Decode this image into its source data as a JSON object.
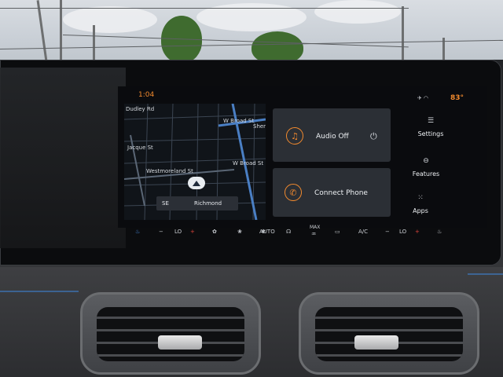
{
  "status": {
    "time": "1:04",
    "temperature": "83°",
    "icons": [
      "mute-icon",
      "wifi-icon"
    ]
  },
  "map": {
    "streets": [
      "Dudley Rd",
      "W Broad St",
      "Shenz",
      "Jacque St",
      "Westmoreland St",
      "W Broad St"
    ],
    "heading": "SE",
    "city": "Richmond"
  },
  "audio_card": {
    "icon": "music-note-icon",
    "label": "Audio Off",
    "power_icon": "power-icon"
  },
  "phone_card": {
    "icon": "phone-icon",
    "label": "Connect Phone"
  },
  "side_menu": {
    "settings": {
      "label": "Settings",
      "icon": "sliders-icon"
    },
    "features": {
      "label": "Features",
      "icon": "car-icon"
    },
    "apps": {
      "label": "Apps",
      "icon": "apps-grid-icon"
    }
  },
  "climate": {
    "minus_left": "−",
    "temp_left": "LO",
    "plus_left": "+",
    "auto": "AUTO",
    "max": "MAX",
    "ac": "A/C",
    "minus_right": "−",
    "temp_right": "LO",
    "plus_right": "+"
  },
  "colors": {
    "accent": "#f28a2e",
    "card": "#2b2f35",
    "screen": "#0a0b0e"
  }
}
